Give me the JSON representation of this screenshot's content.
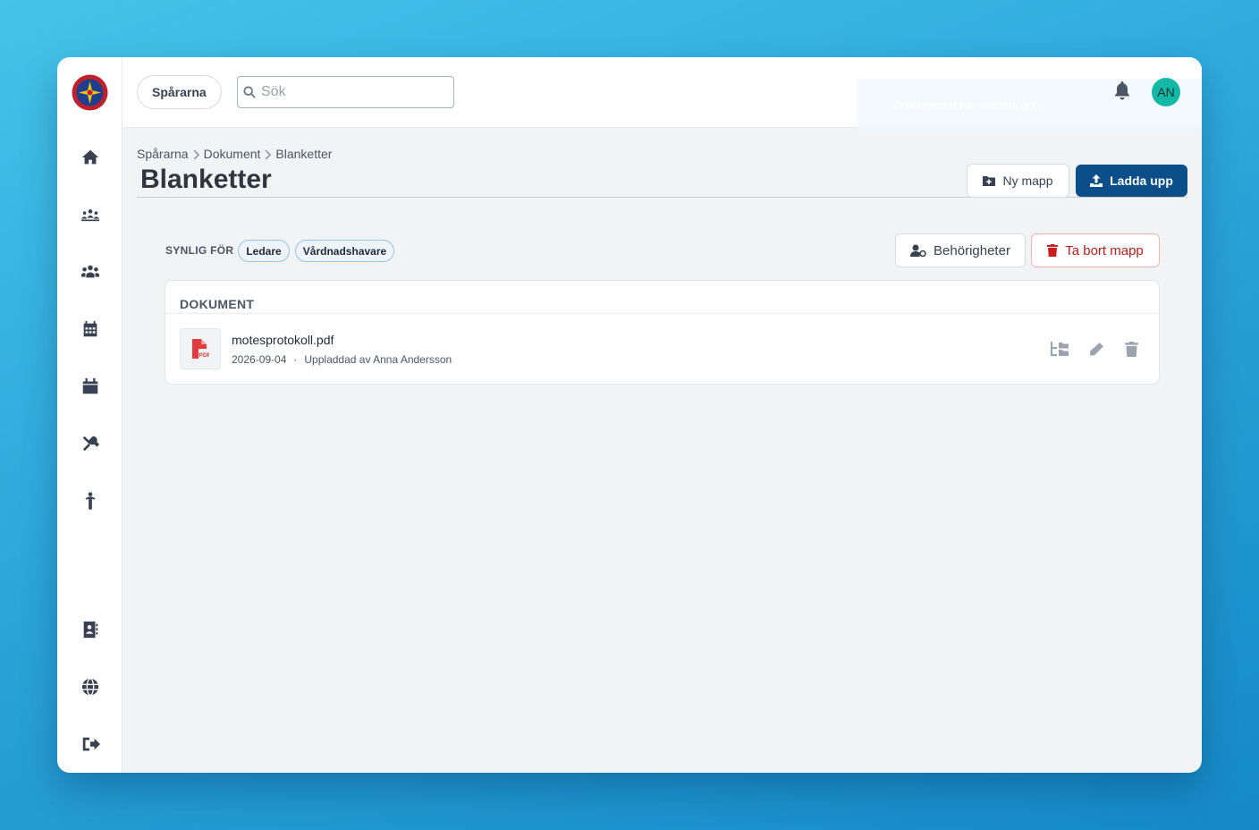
{
  "topbar": {
    "org_label": "Spårarna",
    "search_placeholder": "Sök",
    "toast_text": "Dokumentet har laddats upp",
    "avatar_initials": "AN"
  },
  "breadcrumb": [
    "Spårarna",
    "Dokument",
    "Blanketter"
  ],
  "page": {
    "title": "Blanketter",
    "new_folder_label": "Ny mapp",
    "upload_label": "Ladda upp"
  },
  "visibility": {
    "label": "SYNLIG FÖR",
    "chips": [
      "Ledare",
      "Vårdnadshavare"
    ],
    "permissions_label": "Behörigheter",
    "delete_folder_label": "Ta bort mapp"
  },
  "documents": {
    "header": "DOKUMENT",
    "items": [
      {
        "name": "motesprotokoll.pdf",
        "date": "2026-09-04",
        "separator": "·",
        "uploaded_by": "Uppladdad av Anna Andersson",
        "icon": "pdf-icon"
      }
    ]
  },
  "colors": {
    "primary": "#0b4f8a",
    "danger": "#b91c1c",
    "avatar": "#14b8a6",
    "chip_border": "#93c5e8"
  }
}
